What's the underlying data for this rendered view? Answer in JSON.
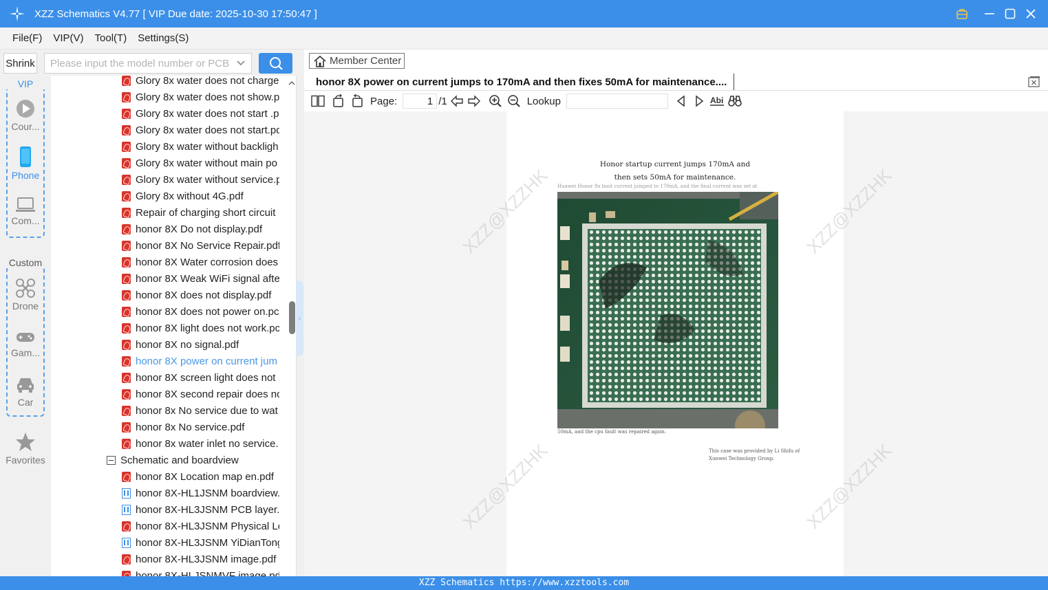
{
  "window": {
    "title": "XZZ Schematics V4.77 [ VIP Due date: 2025-10-30 17:50:47 ]"
  },
  "menu": [
    "File(F)",
    "VIP(V)",
    "Tool(T)",
    "Settings(S)"
  ],
  "search": {
    "shrink_label": "Shrink",
    "placeholder": "Please input the model number or PCB"
  },
  "sidebar": {
    "vip_label": "VIP",
    "custom_label": "Custom",
    "items": [
      {
        "label": "Cour...",
        "icon": "play-icon"
      },
      {
        "label": "Phone",
        "icon": "phone-icon"
      },
      {
        "label": "Com...",
        "icon": "laptop-icon"
      },
      {
        "label": "Drone",
        "icon": "drone-icon"
      },
      {
        "label": "Gam...",
        "icon": "gamepad-icon"
      },
      {
        "label": "Car",
        "icon": "car-icon"
      },
      {
        "label": "Favorites",
        "icon": "star-icon"
      }
    ]
  },
  "tree": {
    "files": [
      {
        "label": "Glory 8x water does not charge.",
        "type": "pdf"
      },
      {
        "label": "Glory 8x water does not show.pc",
        "type": "pdf"
      },
      {
        "label": "Glory 8x water does not start .pc",
        "type": "pdf"
      },
      {
        "label": "Glory 8x water does not start.pd",
        "type": "pdf"
      },
      {
        "label": "Glory 8x water without backligh",
        "type": "pdf"
      },
      {
        "label": "Glory 8x water without main po",
        "type": "pdf"
      },
      {
        "label": "Glory 8x water without service.p",
        "type": "pdf"
      },
      {
        "label": "Glory 8x without 4G.pdf",
        "type": "pdf"
      },
      {
        "label": "Repair of charging short circuit",
        "type": "pdf"
      },
      {
        "label": "honor 8X Do not display.pdf",
        "type": "pdf"
      },
      {
        "label": "honor 8X No Service Repair.pdf",
        "type": "pdf"
      },
      {
        "label": "honor 8X Water corrosion does",
        "type": "pdf"
      },
      {
        "label": "honor 8X Weak WiFi signal afte",
        "type": "pdf"
      },
      {
        "label": "honor 8X does not display.pdf",
        "type": "pdf"
      },
      {
        "label": "honor 8X does not power on.pc",
        "type": "pdf"
      },
      {
        "label": "honor 8X light does not work.pc",
        "type": "pdf"
      },
      {
        "label": "honor 8X no signal.pdf",
        "type": "pdf"
      },
      {
        "label": "honor 8X power on current jum",
        "type": "pdf",
        "selected": true
      },
      {
        "label": "honor 8X screen light does not",
        "type": "pdf"
      },
      {
        "label": "honor 8X second repair does nc",
        "type": "pdf"
      },
      {
        "label": "honor 8x No service due to wat",
        "type": "pdf"
      },
      {
        "label": "honor 8x No service.pdf",
        "type": "pdf"
      },
      {
        "label": "honor 8x water inlet no service.",
        "type": "pdf"
      }
    ],
    "folder": "Schematic and boardview",
    "folder_files": [
      {
        "label": "honor 8X Location map en.pdf",
        "type": "pdf"
      },
      {
        "label": "honor 8X-HL1JSNM boardview.",
        "type": "bv"
      },
      {
        "label": "honor 8X-HL3JSNM PCB layer.p",
        "type": "bv"
      },
      {
        "label": "honor 8X-HL3JSNM Physical Lo",
        "type": "pdf"
      },
      {
        "label": "honor 8X-HL3JSNM YiDianTong",
        "type": "bv"
      },
      {
        "label": "honor 8X-HL3JSNM image.pdf",
        "type": "pdf"
      },
      {
        "label": "honor 8X-HLJSNMVF image.pd",
        "type": "pdf"
      }
    ]
  },
  "viewer": {
    "member_center": "Member Center",
    "doc_tab": "honor 8X power on current jumps to 170mA and then fixes 50mA for maintenance....",
    "page_label": "Page:",
    "page_current": "1",
    "page_total": "/1",
    "lookup_label": "Lookup",
    "lookup_value": ""
  },
  "document": {
    "title_line1": "Honor startup current jumps 170mA and",
    "title_line2": "then sets 50mA for maintenance.",
    "caption_top": "Huawei Honor 8x boot current jumped to 170mA, and the final current was set at",
    "caption_bottom": "50mA, and the cpu fault was repaired again.",
    "credit": "This case was provided by Li Shifu of Xunwei Technology Group.",
    "watermark": "XZZ@XZZHK"
  },
  "status": "XZZ Schematics https://www.xzztools.com",
  "colors": {
    "accent": "#3b8fe8",
    "pdf": "#d9342b",
    "selected": "#4a97e6"
  }
}
